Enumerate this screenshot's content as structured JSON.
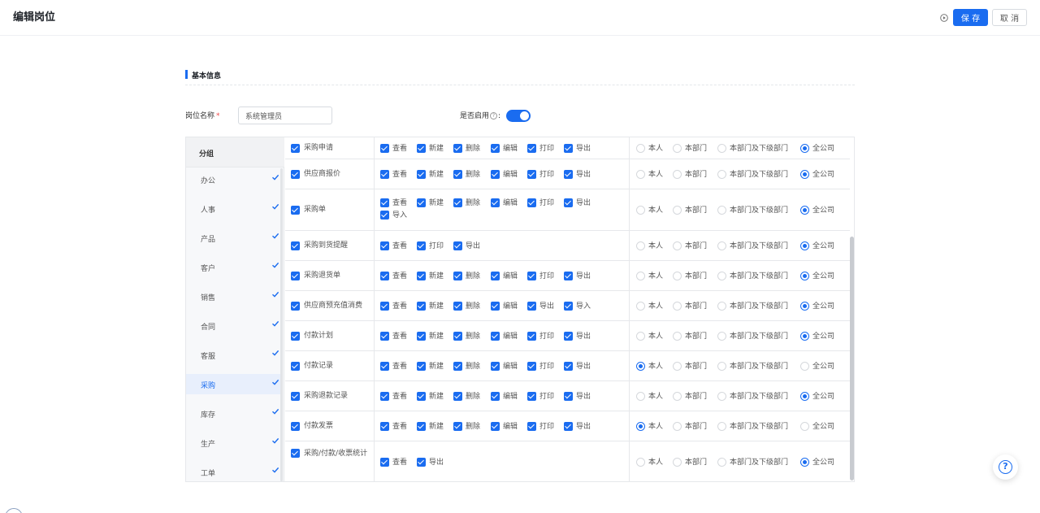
{
  "header": {
    "title": "编辑岗位",
    "save_label": "保 存",
    "cancel_label": "取 消"
  },
  "section": {
    "title": "基本信息"
  },
  "form": {
    "name_label": "岗位名称",
    "required_mark": "*",
    "name_value": "系统管理员",
    "enable_label": "是否启用",
    "enable_suffix": ":",
    "enabled": true
  },
  "groups": {
    "header": "分组",
    "items": [
      "办公",
      "人事",
      "产品",
      "客户",
      "销售",
      "合同",
      "客服",
      "采购",
      "库存",
      "生产",
      "工单"
    ],
    "active": "采购"
  },
  "scope_options": [
    "本人",
    "本部门",
    "本部门及下级部门",
    "全公司"
  ],
  "rows": [
    {
      "name": "采购申请",
      "actions": [
        "查看",
        "新建",
        "删除",
        "编辑",
        "打印",
        "导出"
      ],
      "scope": "全公司"
    },
    {
      "name": "供应商报价",
      "actions": [
        "查看",
        "新建",
        "删除",
        "编辑",
        "打印",
        "导出"
      ],
      "scope": "全公司"
    },
    {
      "name": "采购单",
      "actions": [
        "查看",
        "新建",
        "删除",
        "编辑",
        "打印",
        "导出",
        "导入"
      ],
      "scope": "全公司"
    },
    {
      "name": "采购到货提醒",
      "actions": [
        "查看",
        "打印",
        "导出"
      ],
      "scope": "全公司"
    },
    {
      "name": "采购退货单",
      "actions": [
        "查看",
        "新建",
        "删除",
        "编辑",
        "打印",
        "导出"
      ],
      "scope": "全公司"
    },
    {
      "name": "供应商预充值消费",
      "actions": [
        "查看",
        "新建",
        "删除",
        "编辑",
        "导出",
        "导入"
      ],
      "scope": "全公司"
    },
    {
      "name": "付款计划",
      "actions": [
        "查看",
        "新建",
        "删除",
        "编辑",
        "打印",
        "导出"
      ],
      "scope": "全公司"
    },
    {
      "name": "付款记录",
      "actions": [
        "查看",
        "新建",
        "删除",
        "编辑",
        "打印",
        "导出"
      ],
      "scope": "本人"
    },
    {
      "name": "采购退款记录",
      "actions": [
        "查看",
        "新建",
        "删除",
        "编辑",
        "打印",
        "导出"
      ],
      "scope": "全公司"
    },
    {
      "name": "付款发票",
      "actions": [
        "查看",
        "新建",
        "删除",
        "编辑",
        "打印",
        "导出"
      ],
      "scope": "本人"
    },
    {
      "name": "采购/付款/收票统计",
      "actions": [
        "查看",
        "导出"
      ],
      "scope": "全公司"
    }
  ],
  "colors": {
    "accent": "#1a6cf0"
  }
}
